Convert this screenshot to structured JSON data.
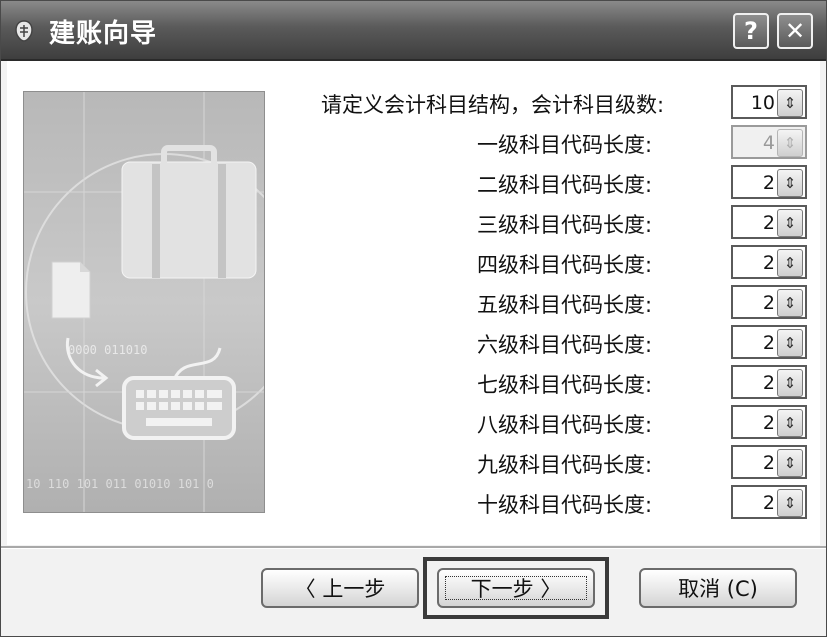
{
  "window": {
    "title": "建账向导",
    "help_label": "?",
    "close_label": "✕"
  },
  "form": {
    "levels_prompt": "请定义会计科目结构，会计科目级数:",
    "levels_value": "10",
    "levels": [
      {
        "label": "一级科目代码长度:",
        "value": "4",
        "disabled": true
      },
      {
        "label": "二级科目代码长度:",
        "value": "2",
        "disabled": false
      },
      {
        "label": "三级科目代码长度:",
        "value": "2",
        "disabled": false
      },
      {
        "label": "四级科目代码长度:",
        "value": "2",
        "disabled": false
      },
      {
        "label": "五级科目代码长度:",
        "value": "2",
        "disabled": false
      },
      {
        "label": "六级科目代码长度:",
        "value": "2",
        "disabled": false
      },
      {
        "label": "七级科目代码长度:",
        "value": "2",
        "disabled": false
      },
      {
        "label": "八级科目代码长度:",
        "value": "2",
        "disabled": false
      },
      {
        "label": "九级科目代码长度:",
        "value": "2",
        "disabled": false
      },
      {
        "label": "十级科目代码长度:",
        "value": "2",
        "disabled": false
      }
    ]
  },
  "buttons": {
    "prev": "〈 上一步",
    "next": "下一步 〉",
    "cancel": "取消 (C)"
  },
  "illustration": {
    "binary_text_1": "0000 011010",
    "binary_text_2": "10 110 101 011 01010 101 0"
  }
}
